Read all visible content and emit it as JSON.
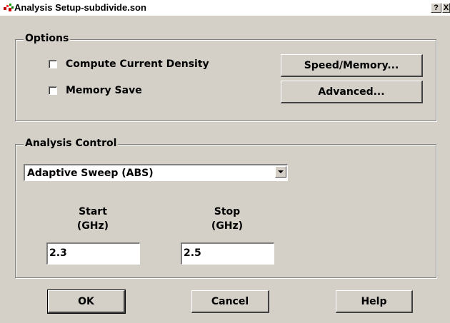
{
  "window": {
    "title": "Analysis Setup-subdivide.son",
    "help_glyph": "?",
    "close_glyph": "X"
  },
  "options": {
    "label": "Options",
    "checkboxes": [
      {
        "label": "Compute Current Density",
        "checked": false
      },
      {
        "label": "Memory Save",
        "checked": false
      }
    ],
    "buttons": {
      "speed_memory": "Speed/Memory...",
      "advanced": "Advanced..."
    }
  },
  "analysis_control": {
    "label": "Analysis Control",
    "sweep_type": {
      "selected": "Adaptive Sweep (ABS)"
    },
    "start": {
      "label_line1": "Start",
      "label_line2": "(GHz)",
      "value": "2.3"
    },
    "stop": {
      "label_line1": "Stop",
      "label_line2": "(GHz)",
      "value": "2.5"
    }
  },
  "footer": {
    "ok": "OK",
    "cancel": "Cancel",
    "help": "Help"
  },
  "colors": {
    "face": "#d4d0c8",
    "shadow": "#808080",
    "highlight": "#ffffff"
  }
}
